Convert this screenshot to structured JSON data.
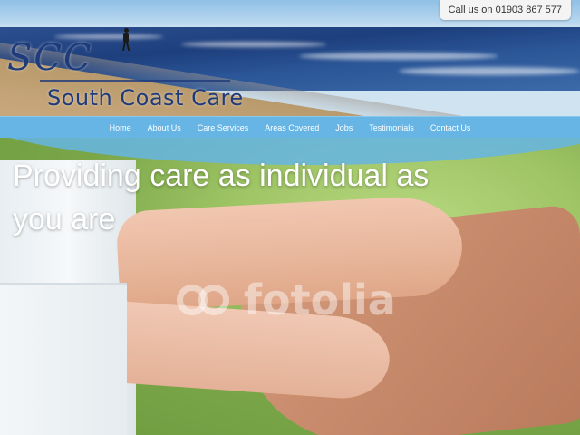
{
  "header": {
    "logo_abbr": "SCC",
    "logo_name": "South Coast Care",
    "phone_cta": "Call us on 01903 867 577"
  },
  "nav": {
    "items": [
      "Home",
      "About Us",
      "Care Services",
      "Areas Covered",
      "Jobs",
      "Testimonials",
      "Contact Us"
    ]
  },
  "hero": {
    "tagline": "Providing care as individual as you are",
    "watermark": "fotolia"
  },
  "colors": {
    "brand_navy": "#1f3b7a",
    "nav_blue": "#66b5e4"
  }
}
